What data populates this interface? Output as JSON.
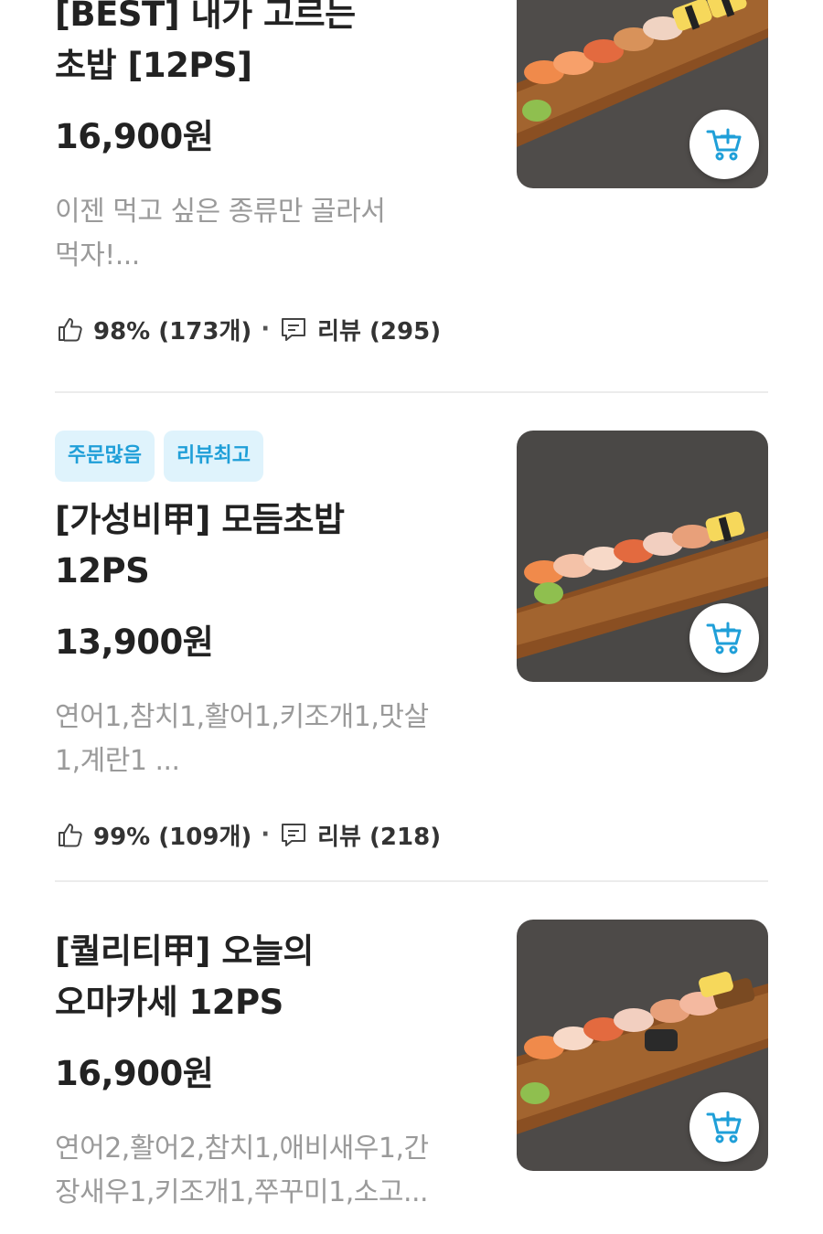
{
  "accent_color": "#1f9fd8",
  "items": [
    {
      "title_lines": [
        "[BEST] 내가 고르는",
        "초밥 [12PS]"
      ],
      "price": "16,900원",
      "desc_lines": [
        "이젠 먹고 싶은 종류만 골라서",
        "먹자!..."
      ],
      "likes": "98% (173개)",
      "separator": "·",
      "reviews": "리뷰 (295)",
      "photo_icon": "sushi-platter-photo"
    },
    {
      "badges": [
        "주문많음",
        "리뷰최고"
      ],
      "title_lines": [
        "[가성비甲] 모듬초밥",
        "12PS"
      ],
      "price": "13,900원",
      "desc_lines": [
        "연어1,참치1,활어1,키조개1,맛살",
        "1,계란1 ..."
      ],
      "likes": "99% (109개)",
      "separator": "·",
      "reviews": "리뷰 (218)",
      "photo_icon": "sushi-platter-photo"
    },
    {
      "title_lines": [
        "[퀄리티甲] 오늘의",
        "오마카세 12PS"
      ],
      "price": "16,900원",
      "desc_lines": [
        "연어2,활어2,참치1,애비새우1,간",
        "장새우1,키조개1,쭈꾸미1,소고..."
      ],
      "photo_icon": "sushi-platter-photo"
    }
  ]
}
